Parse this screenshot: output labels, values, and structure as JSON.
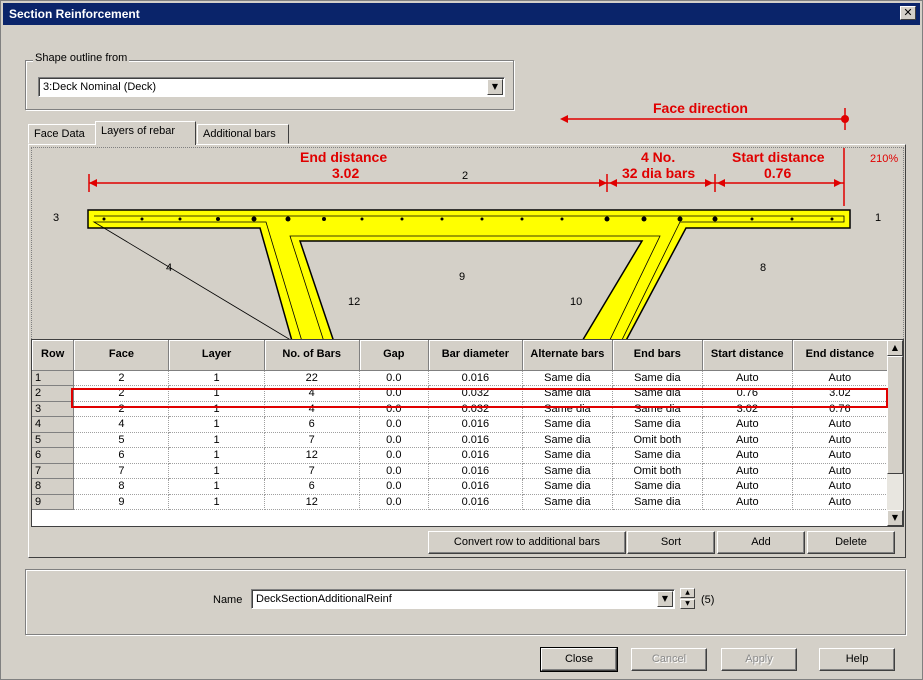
{
  "window": {
    "title": "Section Reinforcement",
    "close_glyph": "✕"
  },
  "shape_outline": {
    "legend": "Shape outline from",
    "value": "3:Deck Nominal (Deck)"
  },
  "tabs": [
    {
      "label": "Face Data"
    },
    {
      "label": "Layers of rebar"
    },
    {
      "label": "Additional bars"
    }
  ],
  "diagram": {
    "face_direction": "Face direction",
    "end_distance_title": "End distance",
    "end_distance_value": "3.02",
    "bars_title": "4 No.",
    "bars_value": "32 dia bars",
    "start_distance_title": "Start distance",
    "start_distance_value": "0.76",
    "zoom": "210%",
    "face_labels": [
      "1",
      "2",
      "3",
      "4",
      "8",
      "9",
      "10",
      "12"
    ],
    "colors": {
      "annotation": "#e00000",
      "section_fill": "#ffff00"
    }
  },
  "table": {
    "headers": [
      "Row",
      "Face",
      "Layer",
      "No. of Bars",
      "Gap",
      "Bar diameter",
      "Alternate bars",
      "End bars",
      "Start distance",
      "End distance"
    ],
    "rows": [
      [
        "1",
        "2",
        "1",
        "22",
        "0.0",
        "0.016",
        "Same dia",
        "Same dia",
        "Auto",
        "Auto"
      ],
      [
        "2",
        "2",
        "1",
        "4",
        "0.0",
        "0.032",
        "Same dia",
        "Same dia",
        "0.76",
        "3.02"
      ],
      [
        "3",
        "2",
        "1",
        "4",
        "0.0",
        "0.032",
        "Same dia",
        "Same dia",
        "3.02",
        "0.76"
      ],
      [
        "4",
        "4",
        "1",
        "6",
        "0.0",
        "0.016",
        "Same dia",
        "Same dia",
        "Auto",
        "Auto"
      ],
      [
        "5",
        "5",
        "1",
        "7",
        "0.0",
        "0.016",
        "Same dia",
        "Omit both",
        "Auto",
        "Auto"
      ],
      [
        "6",
        "6",
        "1",
        "12",
        "0.0",
        "0.016",
        "Same dia",
        "Same dia",
        "Auto",
        "Auto"
      ],
      [
        "7",
        "7",
        "1",
        "7",
        "0.0",
        "0.016",
        "Same dia",
        "Omit both",
        "Auto",
        "Auto"
      ],
      [
        "8",
        "8",
        "1",
        "6",
        "0.0",
        "0.016",
        "Same dia",
        "Same dia",
        "Auto",
        "Auto"
      ],
      [
        "9",
        "9",
        "1",
        "12",
        "0.0",
        "0.016",
        "Same dia",
        "Same dia",
        "Auto",
        "Auto"
      ]
    ]
  },
  "table_buttons": {
    "convert": "Convert row to additional bars",
    "sort": "Sort",
    "add": "Add",
    "delete": "Delete"
  },
  "name_field": {
    "label": "Name",
    "value": "DeckSectionAdditionalReinf",
    "count": "(5)"
  },
  "footer": {
    "close": "Close",
    "cancel": "Cancel",
    "apply": "Apply",
    "help": "Help"
  }
}
